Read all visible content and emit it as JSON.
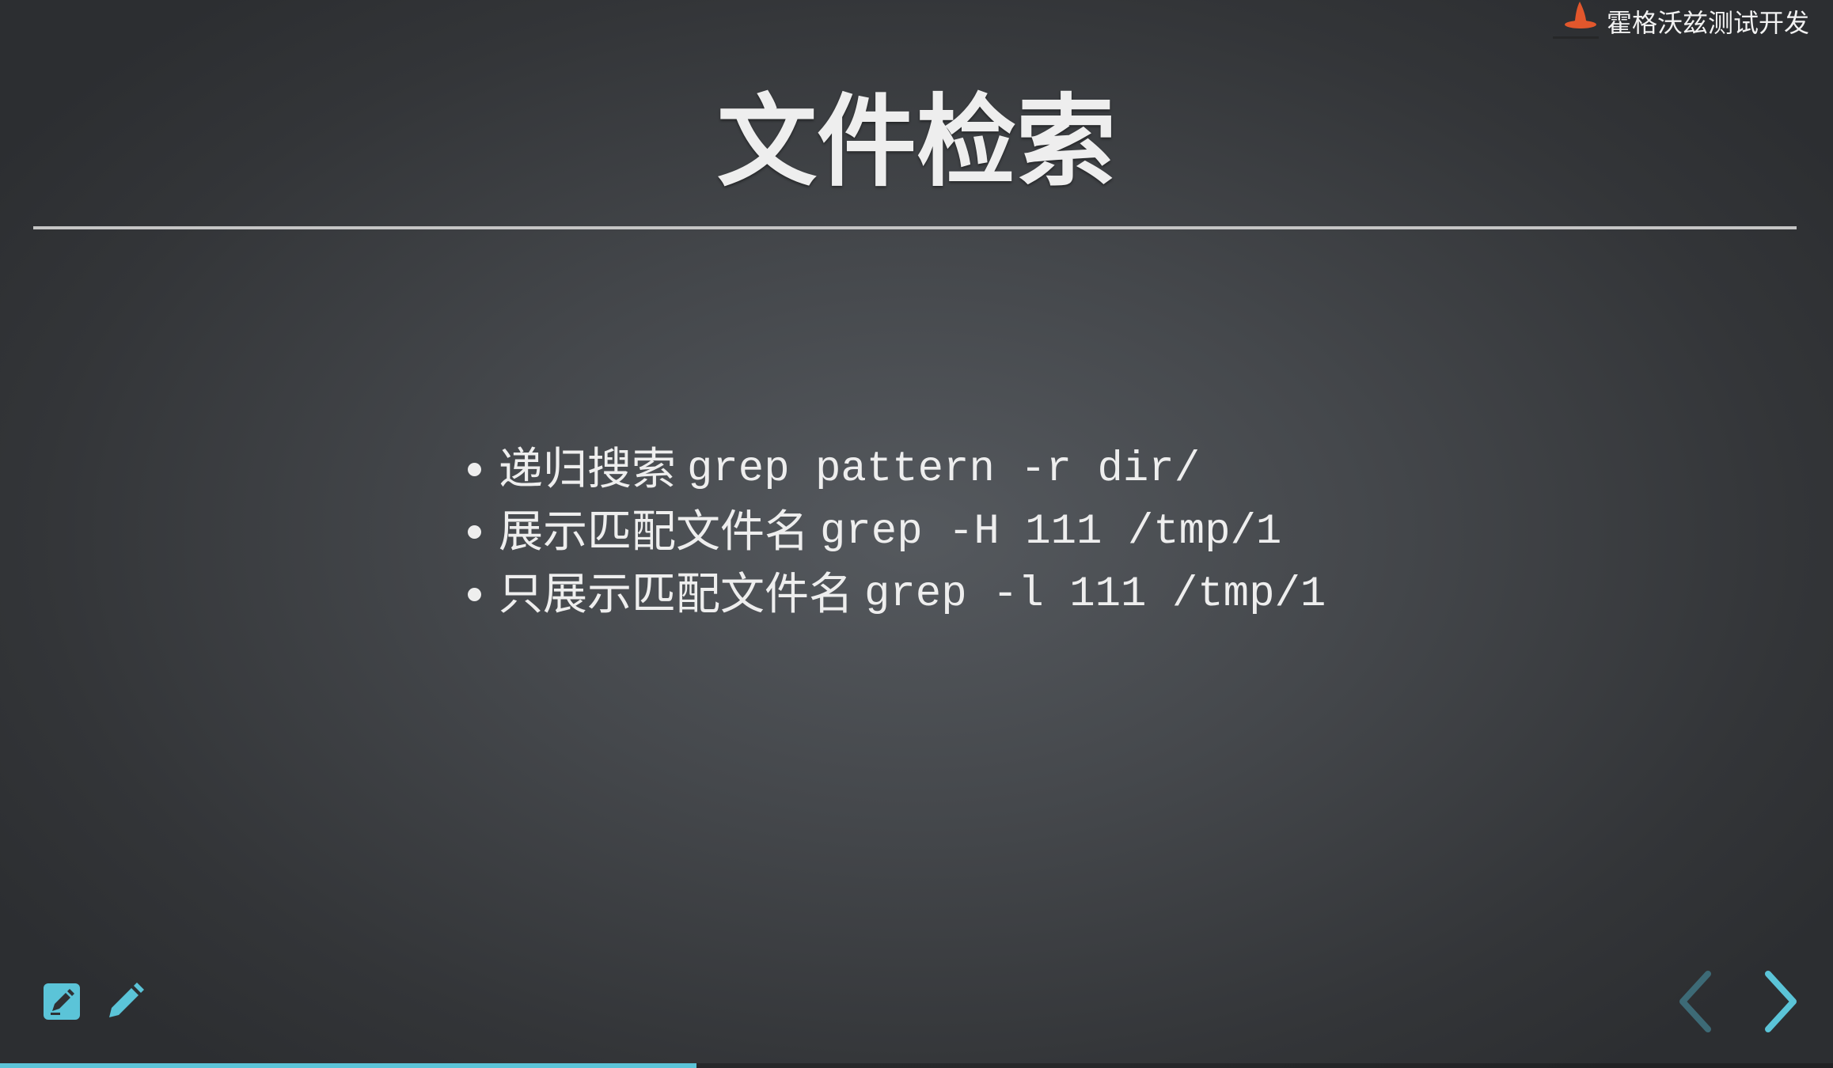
{
  "brand": {
    "text": "霍格沃兹测试开发",
    "logo_icon": "witch-hat-icon"
  },
  "slide": {
    "title": "文件检索",
    "bullets": [
      {
        "label": "递归搜索",
        "code": "grep pattern -r dir/"
      },
      {
        "label": "展示匹配文件名",
        "code": "grep -H 111 /tmp/1"
      },
      {
        "label": "只展示匹配文件名",
        "code": "grep -l 111 /tmp/1"
      }
    ]
  },
  "toolbar": {
    "icons": [
      "edit-note-icon",
      "pencil-icon"
    ]
  },
  "navigation": {
    "prev_icon": "chevron-left-icon",
    "next_icon": "chevron-right-icon",
    "prev_enabled": false,
    "next_enabled": true
  },
  "progress": {
    "fraction": 0.38
  },
  "colors": {
    "accent": "#5bc4d8",
    "text": "#eeeeee",
    "logo": "#e2572c"
  }
}
